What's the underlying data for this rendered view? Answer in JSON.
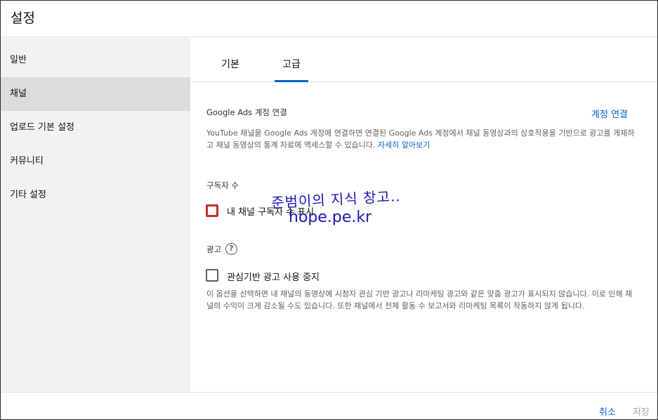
{
  "dialog": {
    "title": "설정"
  },
  "sidebar": {
    "items": [
      {
        "label": "일반"
      },
      {
        "label": "채널"
      },
      {
        "label": "업로드 기본 설정"
      },
      {
        "label": "커뮤니티"
      },
      {
        "label": "기타 설정"
      }
    ],
    "active_index": 1
  },
  "tabs": [
    {
      "label": "기본"
    },
    {
      "label": "고급"
    }
  ],
  "active_tab": 1,
  "google_ads": {
    "title": "Google Ads 계정 연결",
    "link_label": "계정 연결",
    "description": "YouTube 채널을 Google Ads 계정에 연결하면 연결된 Google Ads 계정에서 채널 동영상과의 상호작용을 기반으로 광고를 게재하고 채널 동영상의 통계 자료에 액세스할 수 있습니다.",
    "learn_more": "자세히 알아보기"
  },
  "subscribers": {
    "title": "구독자 수",
    "checkbox_label": "내 채널 구독자 수 표시",
    "checked": false
  },
  "ads": {
    "title": "광고",
    "help_icon": "help-icon",
    "checkbox_label": "관심기반 광고 사용 중지",
    "checked": false,
    "description": "이 옵션을 선택하면 내 채널의 동영상에 시청자 관심 기반 광고나 리마케팅 광고와 같은 맞춤 광고가 표시되지 않습니다. 이로 인해 채널의 수익이 크게 감소될 수도 있습니다. 또한 채널에서 전체 활동 수 보고서와 리마케팅 목록이 작동하지 않게 됩니다."
  },
  "watermark": {
    "line1": "준범이의 지식 창고..",
    "line2": "hope.pe.kr"
  },
  "footer": {
    "cancel_label": "취소",
    "save_label": "저장"
  },
  "colors": {
    "accent": "#065fd4",
    "highlight": "#c0312b",
    "watermark": "#1a17b8"
  }
}
